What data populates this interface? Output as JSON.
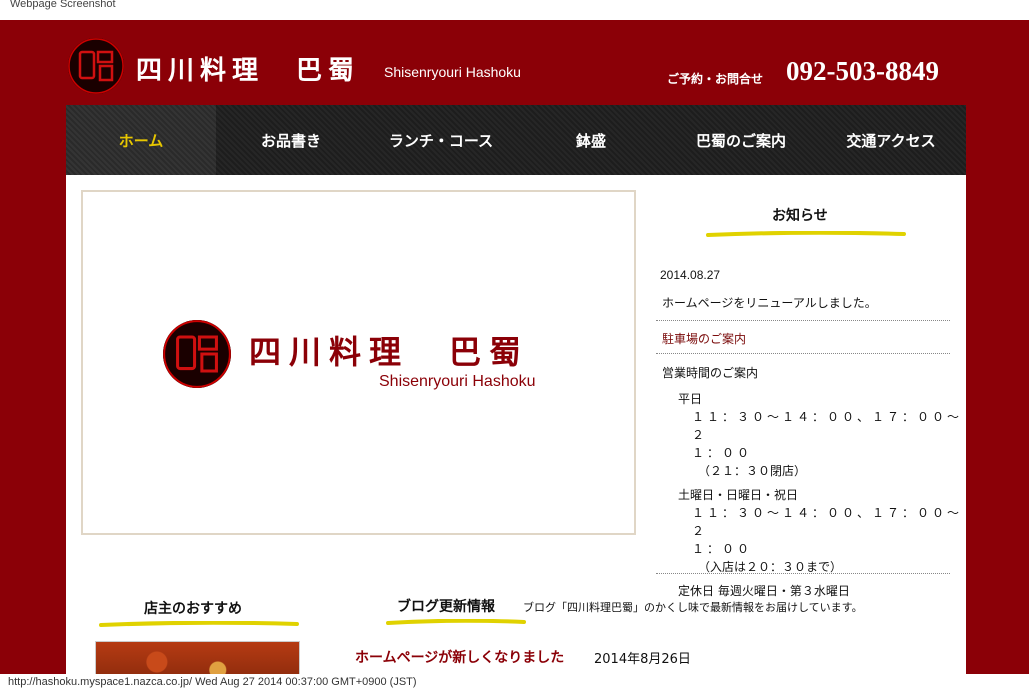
{
  "capture": {
    "top_label": "Webpage Screenshot",
    "bottom_label": "http://hashoku.myspace1.nazca.co.jp/ Wed Aug 27 2014 00:37:00 GMT+0900 (JST)"
  },
  "header": {
    "brand_jp": "四川料理　巴蜀",
    "brand_en": "Shisenryouri Hashoku",
    "contact_label": "ご予約・お問合せ",
    "phone": "092-503-8849"
  },
  "nav": {
    "items": [
      {
        "label": "ホーム"
      },
      {
        "label": "お品書き"
      },
      {
        "label": "ランチ・コース"
      },
      {
        "label": "鉢盛"
      },
      {
        "label": "巴蜀のご案内"
      },
      {
        "label": "交通アクセス"
      }
    ]
  },
  "hero": {
    "title_jp": "四川料理　巴蜀",
    "title_en": "Shisenryouri Hashoku"
  },
  "news": {
    "title": "お知らせ",
    "date": "2014.08.27",
    "message": "ホームページをリニューアルしました。",
    "parking_link": "駐車場のご案内",
    "hours": {
      "heading": "営業時間のご案内",
      "weekday_label": "平日",
      "weekday_time_1": "１１：３０～１４：００、１７：００～２",
      "weekday_time_2": "１：００",
      "weekday_note": "（２１：３０閉店）",
      "holiday_label": "土曜日・日曜日・祝日",
      "holiday_time_1": "１１：３０～１４：００、１７：００～２",
      "holiday_time_2": "１：００",
      "holiday_note": "（入店は２０：３０まで）",
      "closed": "定休日 毎週火曜日・第３水曜日"
    }
  },
  "owner": {
    "title": "店主のおすすめ"
  },
  "blog": {
    "title": "ブログ更新情報",
    "desc": "ブログ「四川料理巴蜀」のかくし味で最新情報をお届けしています。",
    "post_title": "ホームページが新しくなりました",
    "post_date": "2014年8月26日"
  },
  "colors": {
    "brand_red": "#8b0007",
    "nav_active": "#e8c700",
    "underline_yellow": "#e0d200"
  },
  "icons": {
    "logo": "seal-logo-icon"
  }
}
